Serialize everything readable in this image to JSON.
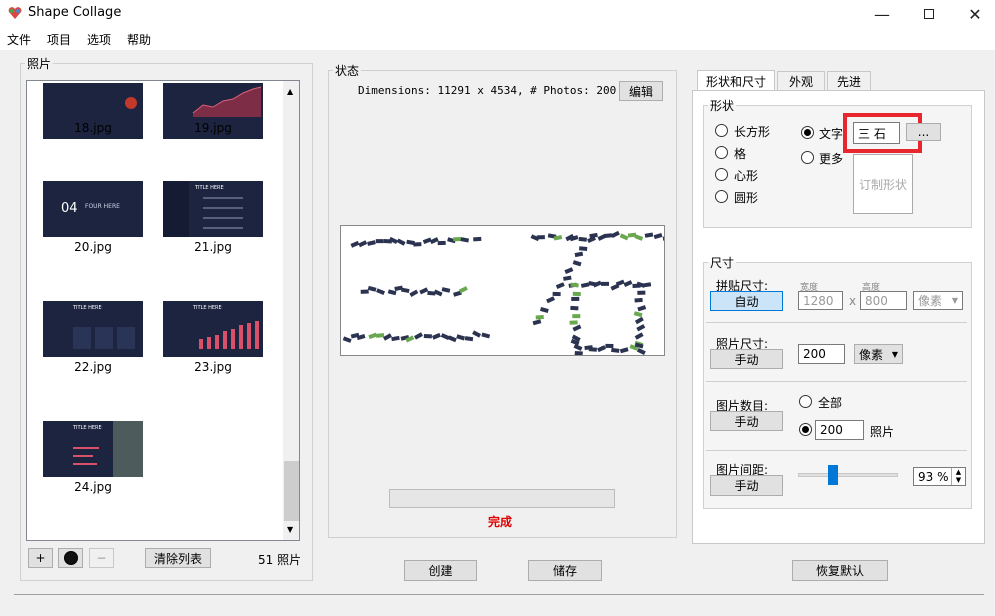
{
  "window": {
    "title": "Shape Collage"
  },
  "menu": [
    "文件",
    "项目",
    "选项",
    "帮助"
  ],
  "photos": {
    "legend": "照片",
    "items": [
      "18.jpg",
      "19.jpg",
      "20.jpg",
      "21.jpg",
      "22.jpg",
      "23.jpg",
      "24.jpg"
    ],
    "thumb_texts": {
      "t20_number": "04",
      "t20_text": "FOUR HERE",
      "title_here": "TITLE HERE"
    },
    "add_label": "+",
    "remove_label": "−",
    "clear_label": "清除列表",
    "count_label": "51 照片"
  },
  "status": {
    "legend": "状态",
    "dimensions": "Dimensions: 11291 x 4534, # Photos: 200",
    "edit_label": "编辑",
    "done_label": "完成",
    "create_label": "创建",
    "save_label": "储存"
  },
  "tabs": [
    "形状和尺寸",
    "外观",
    "先进"
  ],
  "shape": {
    "legend": "形状",
    "options": [
      "长方形",
      "格",
      "心形",
      "圆形"
    ],
    "text_label": "文字",
    "text_value": "三 石",
    "more_label": "更多",
    "browse_label": "...",
    "custom_label": "订制形状",
    "selected": "文字"
  },
  "size": {
    "legend": "尺寸",
    "collage_label": "拼贴尺寸:",
    "auto_label": "自动",
    "width_caption": "宽度",
    "height_caption": "高度",
    "width_value": "1280",
    "x_label": "x",
    "height_value": "800",
    "unit_disabled": "像素",
    "photo_size_label": "照片尺寸:",
    "manual_label": "手动",
    "photo_size_value": "200",
    "photo_unit": "像素",
    "count_label": "图片数目:",
    "all_label": "全部",
    "count_value": "200",
    "photos_unit": "照片",
    "spacing_label": "图片间距:",
    "spacing_value": "93 %",
    "spacing_fraction": 0.3
  },
  "restore_label": "恢复默认",
  "colors": {
    "accent": "#0078d7",
    "highlight": "#e8262d",
    "done": "#e00000",
    "thumb_bg": "#1c2440"
  }
}
